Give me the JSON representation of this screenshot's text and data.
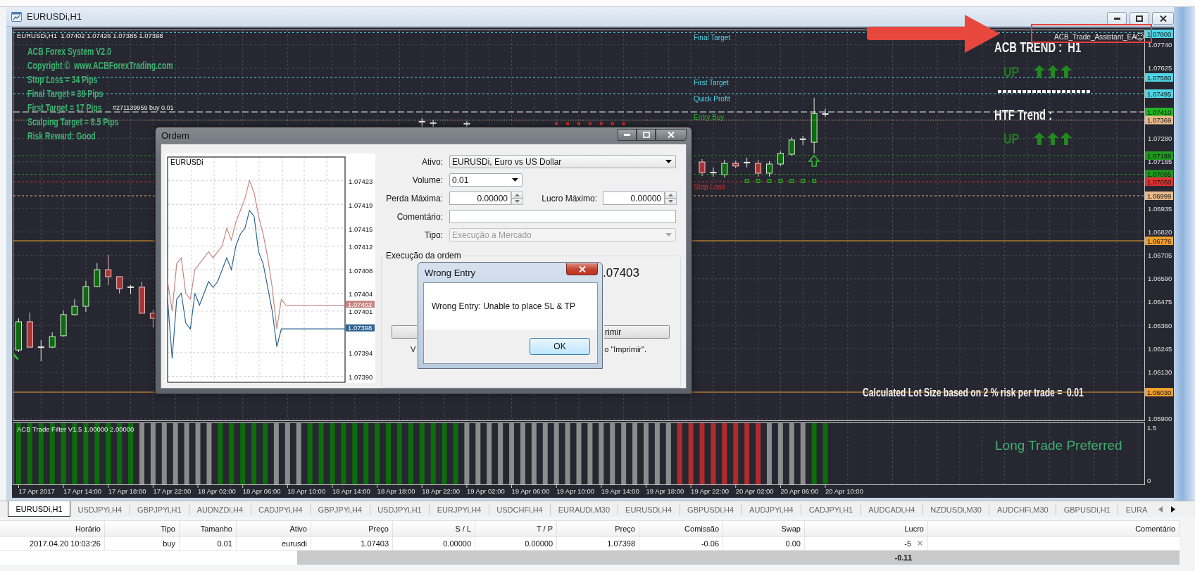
{
  "chart_window": {
    "title": "EURUSDi,H1"
  },
  "chart": {
    "header": "EURUSDi,H1  1.07402 1.07426 1.07385 1.07398",
    "info_lines": [
      "ACB Forex System V2.0",
      "Copyright ©  www.ACBForexTrading.com",
      "Stop Loss = 34 Pips",
      "Final Target = 39 Pips",
      "First Target = 17 Pips",
      "Scalping Target = 8.5 Pips",
      "Risk Reward: Good"
    ],
    "order_marker": "#271139959 buy 0.01",
    "levels": [
      {
        "tag": "1.07800",
        "color": "#4fd6e6",
        "kind": "dashed",
        "label": "Final Target"
      },
      {
        "tag": "1.07580",
        "color": "#4fd6e6",
        "kind": "dashed",
        "label": "First Target"
      },
      {
        "tag": "1.07495",
        "color": "#4fd6e6",
        "kind": "dashed",
        "label": "Quick Profit"
      },
      {
        "tag": "1.07410",
        "color": "#22b422",
        "kind": "order",
        "label": "Entry Buy"
      },
      {
        "tag": "1.07369",
        "color": "#e8b98c",
        "kind": "dotted"
      },
      {
        "tag": "1.07188",
        "color": "#1f9a1f",
        "kind": "dashed"
      },
      {
        "tag": "1.07095",
        "color": "#1f9a1f",
        "kind": "dashed"
      },
      {
        "tag": "1.07050",
        "color": "#e03232",
        "kind": "dashed",
        "label": "Stop Loss"
      },
      {
        "tag": "1.06999",
        "color": "#e8b98c",
        "kind": "dashed"
      },
      {
        "tag": "1.06776",
        "color": "#f0a030",
        "kind": "solid"
      },
      {
        "tag": "1.06030",
        "color": "#f0a030",
        "kind": "solid"
      }
    ],
    "expert": "ACB_Trade_Assistant_EA",
    "trend_panel": [
      {
        "title": "ACB TREND :  H1",
        "direction": "UP"
      },
      {
        "title": "HTF Trend :",
        "direction": "UP"
      }
    ],
    "lot_size": "Calculated Lot Size based on 2 % risk per trade =  0.01",
    "chart_data": {
      "type": "candlestick",
      "categories": [
        null,
        null,
        "17 Apr 2017",
        null,
        null,
        null,
        "17 Apr 14:00",
        null,
        null,
        null,
        "17 Apr 18:00",
        null,
        null,
        null,
        "17 Apr 22:00",
        null,
        null,
        null,
        "18 Apr 02:00",
        null,
        null,
        null,
        "18 Apr 06:00",
        null,
        null,
        null,
        "18 Apr 10:00",
        null,
        null,
        null,
        "18 Apr 14:00",
        null,
        null,
        null,
        "18 Apr 18:00",
        null,
        null,
        null,
        "18 Apr 22:00",
        null,
        null,
        null,
        "19 Apr 02:00",
        null,
        null,
        null,
        "19 Apr 06:00",
        null,
        null,
        null,
        "19 Apr 10:00",
        null,
        null,
        null,
        "19 Apr 14:00",
        null,
        null,
        null,
        "19 Apr 18:00",
        null,
        null,
        null,
        "19 Apr 22:00",
        null,
        null,
        null,
        "20 Apr 02:00",
        null,
        null,
        null,
        "20 Apr 06:00",
        null,
        null,
        null,
        "20 Apr 10:00",
        null,
        null,
        null,
        null,
        null,
        null,
        null,
        null,
        null,
        null,
        null,
        null,
        null,
        null,
        null,
        null,
        null,
        null,
        null,
        null,
        null,
        null,
        null,
        null,
        null,
        null
      ],
      "ohlc": [
        [
          1.06239,
          1.06395,
          1.06229,
          1.06378
        ],
        [
          1.06378,
          1.06423,
          1.0625,
          1.06253
        ],
        [
          1.06253,
          1.06288,
          1.06184,
          1.06253
        ],
        [
          1.06253,
          1.06326,
          1.0625,
          1.06305
        ],
        [
          1.06309,
          1.06433,
          1.06305,
          1.06413
        ],
        [
          1.06413,
          1.06489,
          1.06409,
          1.06454
        ],
        [
          1.06454,
          1.06579,
          1.06426,
          1.06551
        ],
        [
          1.06551,
          1.06666,
          1.06548,
          1.06634
        ],
        [
          1.06634,
          1.06707,
          1.06558,
          1.066
        ],
        [
          1.066,
          1.066,
          1.06517,
          1.06541
        ],
        [
          1.06548,
          1.06558,
          1.06513,
          1.06548
        ],
        [
          1.06548,
          1.06575,
          1.0642,
          1.0642
        ],
        [
          1.0642,
          1.06437,
          1.0635,
          1.06395
        ],
        null,
        null,
        null,
        null,
        null,
        null,
        null,
        null,
        null,
        null,
        null,
        null,
        null,
        null,
        null,
        null,
        null,
        null,
        null,
        null,
        null,
        null,
        null,
        [
          1.07362,
          1.07379,
          1.07337,
          1.07362
        ],
        [
          1.07355,
          1.07372,
          1.07337,
          1.07355
        ],
        null,
        null,
        [
          1.07352,
          1.07365,
          1.07337,
          1.07352
        ],
        null,
        null,
        null,
        null,
        null,
        null,
        null,
        null,
        null,
        null,
        null,
        null,
        null,
        null,
        null,
        null,
        null,
        null,
        null,
        null,
        [
          1.07164,
          1.07178,
          1.07095,
          1.07112
        ],
        [
          1.07112,
          1.07137,
          1.07092,
          1.07112
        ],
        [
          1.07102,
          1.07175,
          1.07088,
          1.07157
        ],
        [
          1.07157,
          1.07171,
          1.07133,
          1.07144
        ],
        [
          1.07161,
          1.07185,
          1.07137,
          1.07161
        ],
        [
          1.07157,
          1.07175,
          1.07092,
          1.07109
        ],
        [
          1.07109,
          1.07168,
          1.07092,
          1.07154
        ],
        [
          1.07154,
          1.07216,
          1.07144,
          1.07206
        ],
        [
          1.07202,
          1.07285,
          1.07192,
          1.07272
        ],
        [
          1.07276,
          1.07292,
          1.07247,
          1.07276
        ],
        [
          1.07261,
          1.0748,
          1.07206,
          1.07402
        ],
        [
          1.07402,
          1.07426,
          1.07385,
          1.07398
        ],
        null,
        null,
        null,
        null,
        null,
        null,
        null,
        null,
        null,
        null,
        null,
        null,
        null,
        null,
        null,
        null,
        null,
        null,
        null,
        null,
        null,
        null,
        null,
        null,
        null,
        null,
        null,
        null
      ],
      "ylim": [
        1.05893,
        1.07812
      ],
      "yticks": [
        {
          "value": 1.0774,
          "label": "1.07740"
        },
        {
          "value": 1.07625,
          "label": "1.07625"
        },
        {
          "value": 1.0728,
          "label": "1.07280"
        },
        {
          "value": 1.07165,
          "label": "1.07165"
        },
        {
          "value": 1.06935,
          "label": "1.06935"
        },
        {
          "value": 1.0682,
          "label": "1.06820"
        },
        {
          "value": 1.06705,
          "label": "1.06705"
        },
        {
          "value": 1.0659,
          "label": "1.06590"
        },
        {
          "value": 1.06475,
          "label": "1.06475"
        },
        {
          "value": 1.0636,
          "label": "1.06360"
        },
        {
          "value": 1.06245,
          "label": "1.06245"
        },
        {
          "value": 1.0613,
          "label": "1.06130"
        },
        {
          "value": 1.059,
          "label": "1.05900"
        }
      ],
      "grid": true
    }
  },
  "indicator": {
    "title": "ACB Trade Filter V1.5 1.00000 2.00000",
    "scale": [
      "1.5",
      "0"
    ],
    "signal": "Long Trade Preferred"
  },
  "symbol_tabs": [
    {
      "label": "EURUSDi,H1",
      "selected": true
    },
    {
      "label": "USDJPYi,H4",
      "selected": false
    },
    {
      "label": "GBPJPYi,H1",
      "selected": false
    },
    {
      "label": "AUDNZDi,H4",
      "selected": false
    },
    {
      "label": "CADJPYi,H4",
      "selected": false
    },
    {
      "label": "GBPJPYi,H4",
      "selected": false
    },
    {
      "label": "USDJPYi,H1",
      "selected": false
    },
    {
      "label": "EURJPYi,H4",
      "selected": false
    },
    {
      "label": "USDCHFi,H4",
      "selected": false
    },
    {
      "label": "EURAUDi,M30",
      "selected": false
    },
    {
      "label": "EURUSDi,H4",
      "selected": false
    },
    {
      "label": "GBPUSDi,H4",
      "selected": false
    },
    {
      "label": "AUDJPYi,H4",
      "selected": false
    },
    {
      "label": "CADJPYi,H1",
      "selected": false
    },
    {
      "label": "AUDCADi,H4",
      "selected": false
    },
    {
      "label": "NZDUSDi,M30",
      "selected": false
    },
    {
      "label": "AUDCHFi,M30",
      "selected": false
    },
    {
      "label": "GBPUSDi,H1",
      "selected": false
    },
    {
      "label": "EURA",
      "selected": false
    }
  ],
  "order_dialog": {
    "title": "Ordem",
    "chart": {
      "symbol": "EURUSDi",
      "price_tags": [
        "1.07402",
        "1.07398"
      ],
      "chart_data": {
        "type": "line",
        "ylim": [
          1.07389,
          1.07427
        ],
        "grid": true,
        "yticks": [
          {
            "value": 1.07423,
            "label": "1.07423"
          },
          {
            "value": 1.07419,
            "label": "1.07419"
          },
          {
            "value": 1.07415,
            "label": "1.07415"
          },
          {
            "value": 1.07412,
            "label": "1.07412"
          },
          {
            "value": 1.07408,
            "label": "1.07408"
          },
          {
            "value": 1.07404,
            "label": "1.07404"
          },
          {
            "value": 1.07401,
            "label": "1.07401"
          },
          {
            "value": 1.07394,
            "label": "1.07394"
          },
          {
            "value": 1.0739,
            "label": "1.07390"
          }
        ],
        "series": [
          {
            "color": "#c58683",
            "values": [
              1.07406,
              1.07401,
              1.07409,
              1.0741,
              1.07404,
              1.07403,
              1.07408,
              1.07409,
              1.0741,
              1.07411,
              1.0741,
              1.07411,
              1.07412,
              1.07415,
              1.07413,
              1.07416,
              1.07418,
              1.0742,
              1.07423,
              1.07421,
              1.07417,
              1.07414,
              1.0741,
              1.07405,
              1.07398,
              1.07403,
              1.07402,
              1.07402,
              1.07402,
              1.07402,
              1.07402,
              1.07402,
              1.07402,
              1.07402,
              1.07402,
              1.07402,
              1.07402,
              1.07402,
              1.07402,
              1.07402
            ]
          },
          {
            "color": "#2f6391",
            "values": [
              1.07403,
              1.07393,
              1.07403,
              1.07404,
              1.07399,
              1.07398,
              1.07404,
              1.07402,
              1.07404,
              1.07406,
              1.07405,
              1.07406,
              1.07408,
              1.0741,
              1.07408,
              1.07412,
              1.07414,
              1.07415,
              1.07418,
              1.07417,
              1.07411,
              1.07409,
              1.07405,
              1.07401,
              1.07395,
              1.07398,
              1.07398,
              1.07398,
              1.07398,
              1.07398,
              1.07398,
              1.07398,
              1.07398,
              1.07398,
              1.07398,
              1.07398,
              1.07398,
              1.07398,
              1.07398,
              1.07398
            ]
          }
        ]
      }
    },
    "rows": [
      {
        "fields": [
          {
            "label": "Ativo:",
            "value": "EURUSDi, Euro vs US Dollar",
            "kind": "dropdown",
            "disabled": false
          }
        ]
      },
      {
        "fields": [
          {
            "label": "Volume:",
            "value": "0.01",
            "kind": "dropdown",
            "disabled": false
          }
        ]
      },
      {
        "fields": [
          {
            "label": "Perda Máxima:",
            "value": "0.00000",
            "kind": "spinner",
            "disabled": false
          },
          {
            "label": "Lucro Máximo:",
            "value": "0.00000",
            "kind": "spinner",
            "disabled": false
          }
        ]
      },
      {
        "fields": [
          {
            "label": "Comentário:",
            "kind": "text",
            "disabled": false
          }
        ]
      },
      {
        "fields": [
          {
            "label": "Tipo:",
            "value": "Execução a Mercado",
            "kind": "dropdown",
            "disabled": true
          }
        ]
      }
    ],
    "execution": {
      "title": "Execução da ordem",
      "price": ".07403",
      "button": "rimir",
      "note_start": "V",
      "note_end": "o \"Imprimir\"."
    }
  },
  "alert_dialog": {
    "title": "Wrong Entry",
    "message": "Wrong Entry: Unable to place SL & TP",
    "button": "OK"
  },
  "trade_table": {
    "columns": [
      "Horário",
      "Tipo",
      "Tamanho",
      "Ativo",
      "Preço",
      "S / L",
      "T / P",
      "Preço",
      "Comissão",
      "Swap",
      "Lucro",
      "Comentário"
    ],
    "rows": [
      {
        "cells": [
          "2017.04.20 10:03:26",
          "buy",
          "0.01",
          "eurusdi",
          "1.07403",
          "0.00000",
          "0.00000",
          "1.07398",
          "-0.06",
          "0.00",
          "-5"
        ]
      }
    ],
    "total": "-0.11"
  }
}
